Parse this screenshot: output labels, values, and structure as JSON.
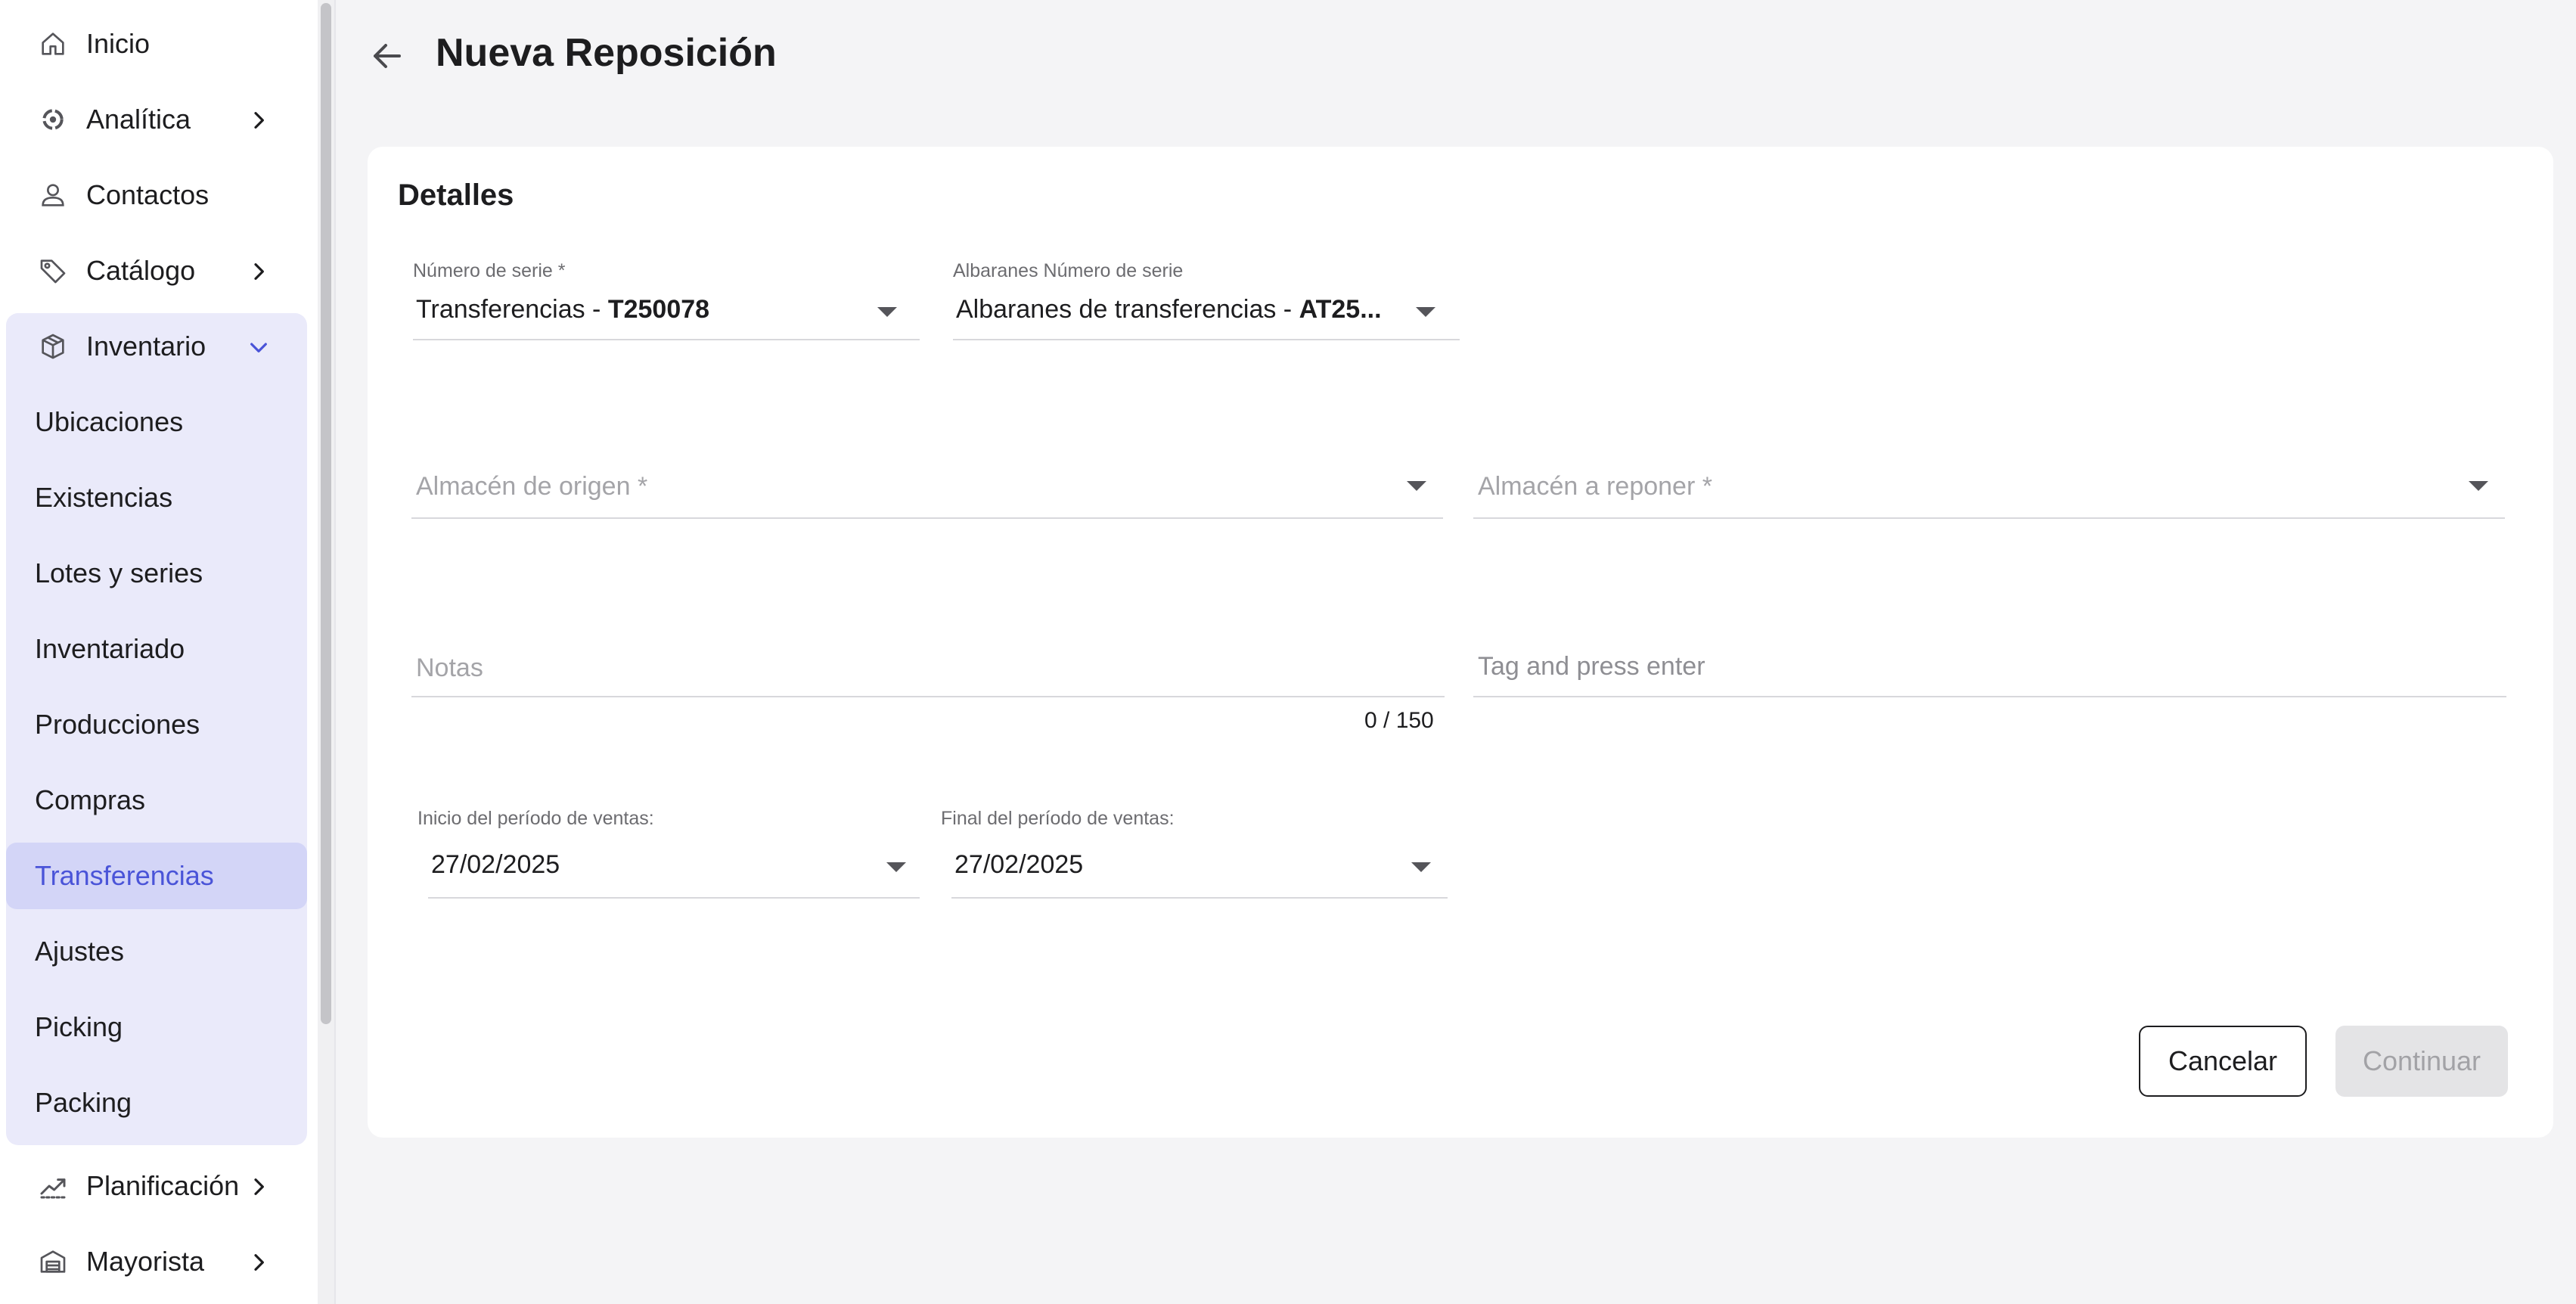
{
  "sidebar": {
    "items": [
      {
        "label": "Inicio",
        "icon": "home-icon"
      },
      {
        "label": "Analítica",
        "icon": "analytics-icon"
      },
      {
        "label": "Contactos",
        "icon": "contacts-icon"
      },
      {
        "label": "Catálogo",
        "icon": "tag-icon"
      },
      {
        "label": "Inventario",
        "icon": "box-icon"
      },
      {
        "label": "Planificación",
        "icon": "trend-icon"
      },
      {
        "label": "Mayorista",
        "icon": "warehouse-icon"
      }
    ],
    "inventory_subitems": [
      "Ubicaciones",
      "Existencias",
      "Lotes y series",
      "Inventariado",
      "Producciones",
      "Compras",
      "Transferencias",
      "Ajustes",
      "Picking",
      "Packing"
    ],
    "active_subitem": "Transferencias"
  },
  "header": {
    "title": "Nueva Reposición"
  },
  "details": {
    "title": "Detalles",
    "serie": {
      "label": "Número de serie *",
      "value_prefix": "Transferencias - ",
      "value_code": "T250078"
    },
    "albaranes_serie": {
      "label": "Albaranes Número de serie",
      "value_prefix": "Albaranes de transferencias - ",
      "value_code": "AT25..."
    },
    "almacen_origen": {
      "placeholder": "Almacén de origen *"
    },
    "almacen_reponer": {
      "placeholder": "Almacén a reponer *"
    },
    "notas": {
      "placeholder": "Notas",
      "counter": "0 / 150"
    },
    "tags": {
      "placeholder": "Tag and press enter"
    },
    "inicio_periodo": {
      "label": "Inicio del período de ventas:",
      "value": "27/02/2025"
    },
    "final_periodo": {
      "label": "Final del período de ventas:",
      "value": "27/02/2025"
    }
  },
  "actions": {
    "cancel": "Cancelar",
    "continue": "Continuar"
  },
  "colors": {
    "accent": "#4a54d8",
    "active_bg": "#d3d5f7",
    "group_bg": "#eaeafa"
  }
}
